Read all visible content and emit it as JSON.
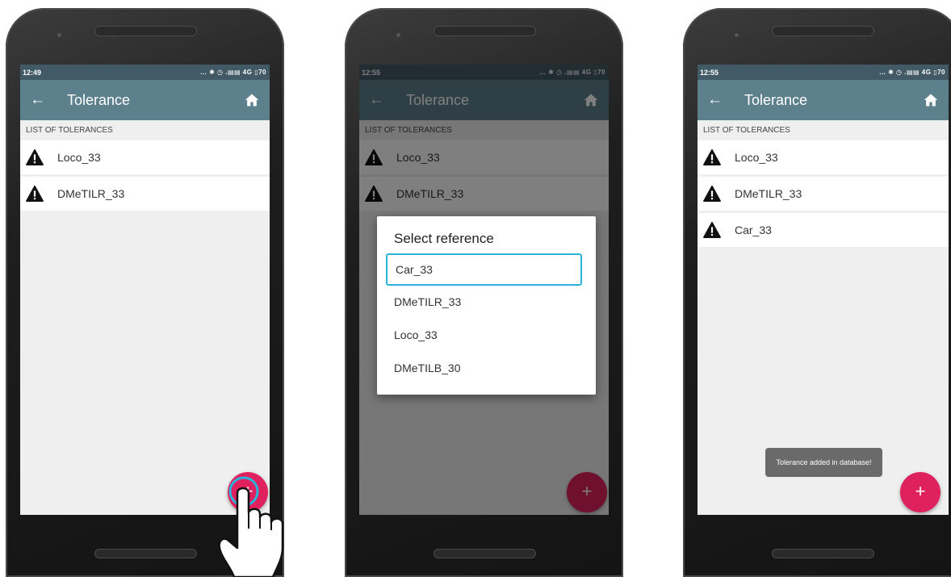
{
  "screens": [
    {
      "status_time": "12:49",
      "status_icons": "... ✱ ◷ .▤▤ 4G ▯70",
      "toolbar": {
        "title": "Tolerance"
      },
      "section_header": "LIST OF TOLERANCES",
      "items": [
        "Loco_33",
        "DMeTILR_33"
      ],
      "fab_label": "+"
    },
    {
      "status_time": "12:55",
      "status_icons": "... ✱ ◷ .▤▤ 4G ▯70",
      "toolbar": {
        "title": "Tolerance"
      },
      "section_header": "LIST OF TOLERANCES",
      "items": [
        "Loco_33",
        "DMeTILR_33"
      ],
      "fab_label": "+",
      "dialog": {
        "title": "Select reference",
        "options": [
          "Car_33",
          "DMeTILR_33",
          "Loco_33",
          "DMeTILB_30"
        ],
        "selected_index": 0
      }
    },
    {
      "status_time": "12:55",
      "status_icons": "... ✱ ◷ .▤▤ 4G ▯70",
      "toolbar": {
        "title": "Tolerance"
      },
      "section_header": "LIST OF TOLERANCES",
      "items": [
        "Loco_33",
        "DMeTILR_33",
        "Car_33"
      ],
      "fab_label": "+",
      "toast": "Tolerance added in database!"
    }
  ],
  "colors": {
    "toolbar": "#5d808d",
    "statusbar": "#425a66",
    "fab": "#e0215f",
    "dialog_highlight": "#2bb3dc"
  },
  "icons": {
    "back": "arrow-left-icon",
    "home": "home-icon",
    "item": "warning-icon",
    "fab": "plus-icon",
    "pointer": "hand-pointer-icon"
  }
}
